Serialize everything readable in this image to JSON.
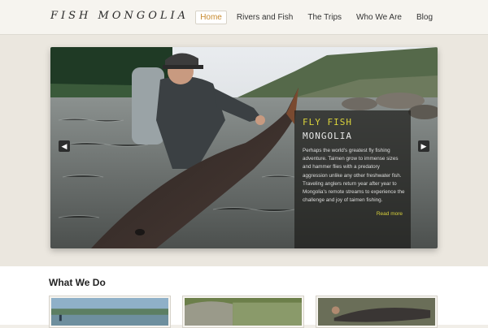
{
  "site": {
    "logo_text": "FISH MONGOLIA"
  },
  "nav": {
    "items": [
      {
        "label": "Home",
        "active": true
      },
      {
        "label": "Rivers and Fish",
        "active": false
      },
      {
        "label": "The Trips",
        "active": false
      },
      {
        "label": "Who We Are",
        "active": false
      },
      {
        "label": "Blog",
        "active": false
      }
    ]
  },
  "hero": {
    "title_line1": "FLY FISH",
    "title_line2": "MONGOLIA",
    "body": "Perhaps the world's greatest fly fishing adventure.  Taimen grow to immense sizes and hammer flies with a predatory aggression unlike any other freshwater fish.  Traveling anglers return year after year to Mongolia's remote streams to experience the challenge and joy of taimen fishing.",
    "read_more": "Read more",
    "prev_icon": "chevron-left-icon",
    "next_icon": "chevron-right-icon"
  },
  "what_we_do": {
    "heading": "What We Do"
  },
  "colors": {
    "accent": "#c78a2e",
    "caption_title": "#d9d23a",
    "page_bg": "#f1eee8"
  }
}
